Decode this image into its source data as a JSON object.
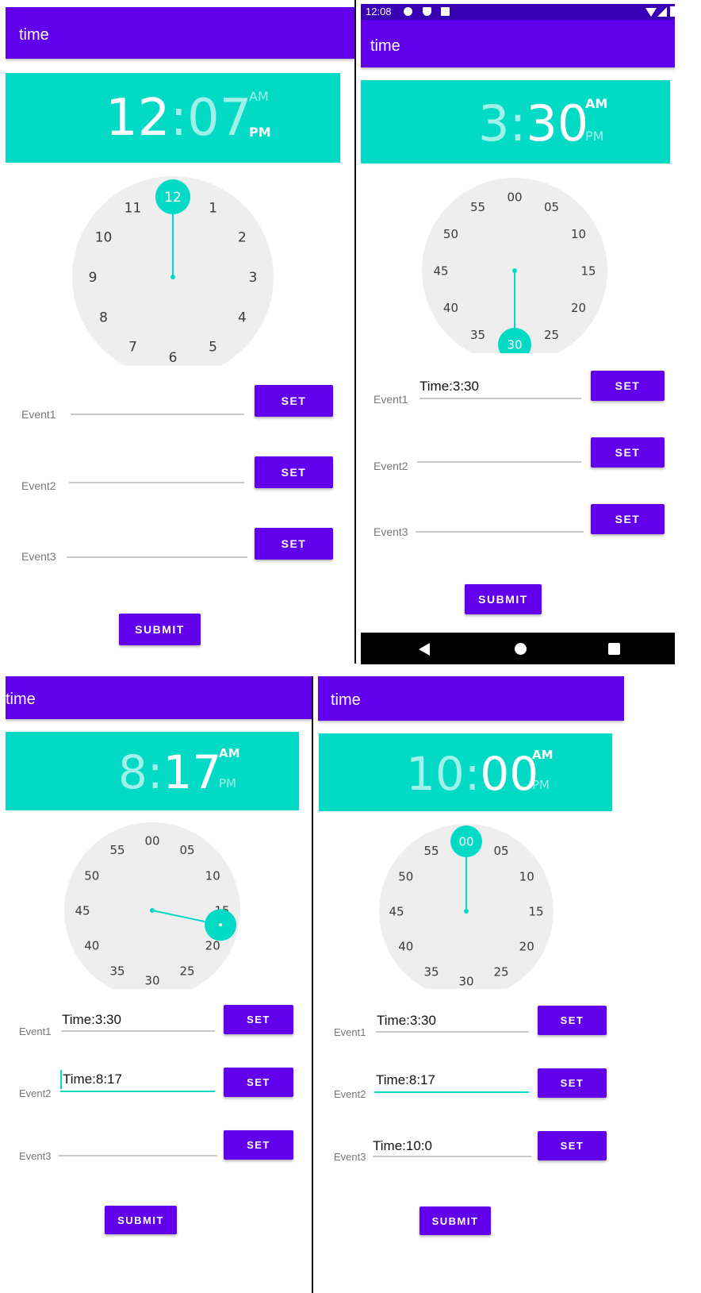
{
  "app": {
    "title": "time"
  },
  "ampm": {
    "am": "AM",
    "pm": "PM"
  },
  "buttons": {
    "set": "SET",
    "submit": "SUBMIT"
  },
  "events": {
    "e1": "Event1",
    "e2": "Event2",
    "e3": "Event3"
  },
  "status_bar": {
    "time": "12:08",
    "icons": [
      "gear-icon",
      "shield-icon",
      "sd-card-icon",
      "wifi-icon",
      "signal-icon",
      "battery-icon"
    ]
  },
  "nav_bar": {
    "icons": [
      "back-icon",
      "home-icon",
      "recents-icon"
    ]
  },
  "colors": {
    "primary": "#6200EE",
    "primary_dark": "#3700B3",
    "accent": "#03DAC5"
  },
  "screens": [
    {
      "time": {
        "hour": "12",
        "sep": ":",
        "minute": "07"
      },
      "selected_field": "hour",
      "selected_ampm": "pm",
      "clock": {
        "mode": "hours",
        "labels": [
          "12",
          "1",
          "2",
          "3",
          "4",
          "5",
          "6",
          "7",
          "8",
          "9",
          "10",
          "11"
        ],
        "selected": "12"
      },
      "fields": [
        "",
        "",
        ""
      ]
    },
    {
      "time": {
        "hour": "3",
        "sep": ":",
        "minute": "30"
      },
      "selected_field": "minute",
      "selected_ampm": "am",
      "clock": {
        "mode": "minutes",
        "labels": [
          "00",
          "05",
          "10",
          "15",
          "20",
          "25",
          "30",
          "35",
          "40",
          "45",
          "50",
          "55"
        ],
        "selected": "30"
      },
      "fields": [
        "Time:3:30",
        "",
        ""
      ]
    },
    {
      "time": {
        "hour": "8",
        "sep": ":",
        "minute": "17"
      },
      "selected_field": "minute",
      "selected_ampm": "am",
      "clock": {
        "mode": "minutes",
        "labels": [
          "00",
          "05",
          "10",
          "15",
          "20",
          "25",
          "30",
          "35",
          "40",
          "45",
          "50",
          "55"
        ],
        "selected_minute": 17
      },
      "fields": [
        "Time:3:30",
        "Time:8:17",
        ""
      ]
    },
    {
      "time": {
        "hour": "10",
        "sep": ":",
        "minute": "00"
      },
      "selected_field": "hour",
      "selected_ampm": "am",
      "clock": {
        "mode": "minutes",
        "labels": [
          "00",
          "05",
          "10",
          "15",
          "20",
          "25",
          "30",
          "35",
          "40",
          "45",
          "50",
          "55"
        ],
        "selected": "00"
      },
      "fields": [
        "Time:3:30",
        "Time:8:17",
        "Time:10:0"
      ]
    }
  ]
}
